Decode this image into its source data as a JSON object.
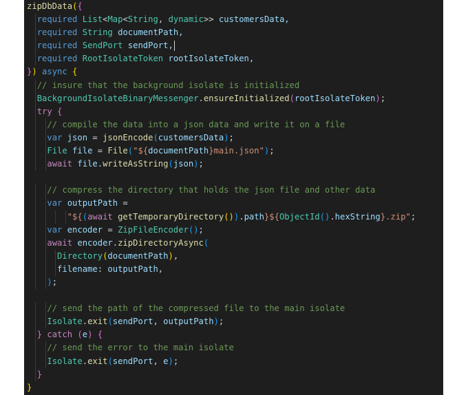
{
  "editor": {
    "lines": [
      "zipDbData({",
      "  required List<Map<String, dynamic>> customersData,",
      "  required String documentPath,",
      "  required SendPort sendPort,",
      "  required RootIsolateToken rootIsolateToken,",
      "}) async {",
      "  // insure that the background isolate is initialized",
      "  BackgroundIsolateBinaryMessenger.ensureInitialized(rootIsolateToken);",
      "  try {",
      "    // compile the data into a json data and write it on a file",
      "    var json = jsonEncode(customersData);",
      "    File file = File(\"${documentPath}main.json\");",
      "    await file.writeAsString(json);",
      "",
      "    // compress the directory that holds the json file and other data",
      "    var outputPath =",
      "        \"${(await getTemporaryDirectory()).path}${ObjectId().hexString}.zip\";",
      "    var encoder = ZipFileEncoder();",
      "    await encoder.zipDirectoryAsync(",
      "      Directory(documentPath),",
      "      filename: outputPath,",
      "    );",
      "",
      "    // send the path of the compressed file to the main isolate",
      "    Isolate.exit(sendPort, outputPath);",
      "  } catch (e) {",
      "    // send the error to the main isolate",
      "    Isolate.exit(sendPort, e);",
      "  }",
      "}"
    ]
  },
  "colors": {
    "background": "#1e1e1e",
    "keyword": "#569cd6",
    "control": "#c586c0",
    "type": "#4ec9b0",
    "function": "#dcdcaa",
    "variable": "#9cdcfe",
    "string": "#ce9178",
    "comment": "#6a9955",
    "bracket_gold": "#ffd700"
  }
}
